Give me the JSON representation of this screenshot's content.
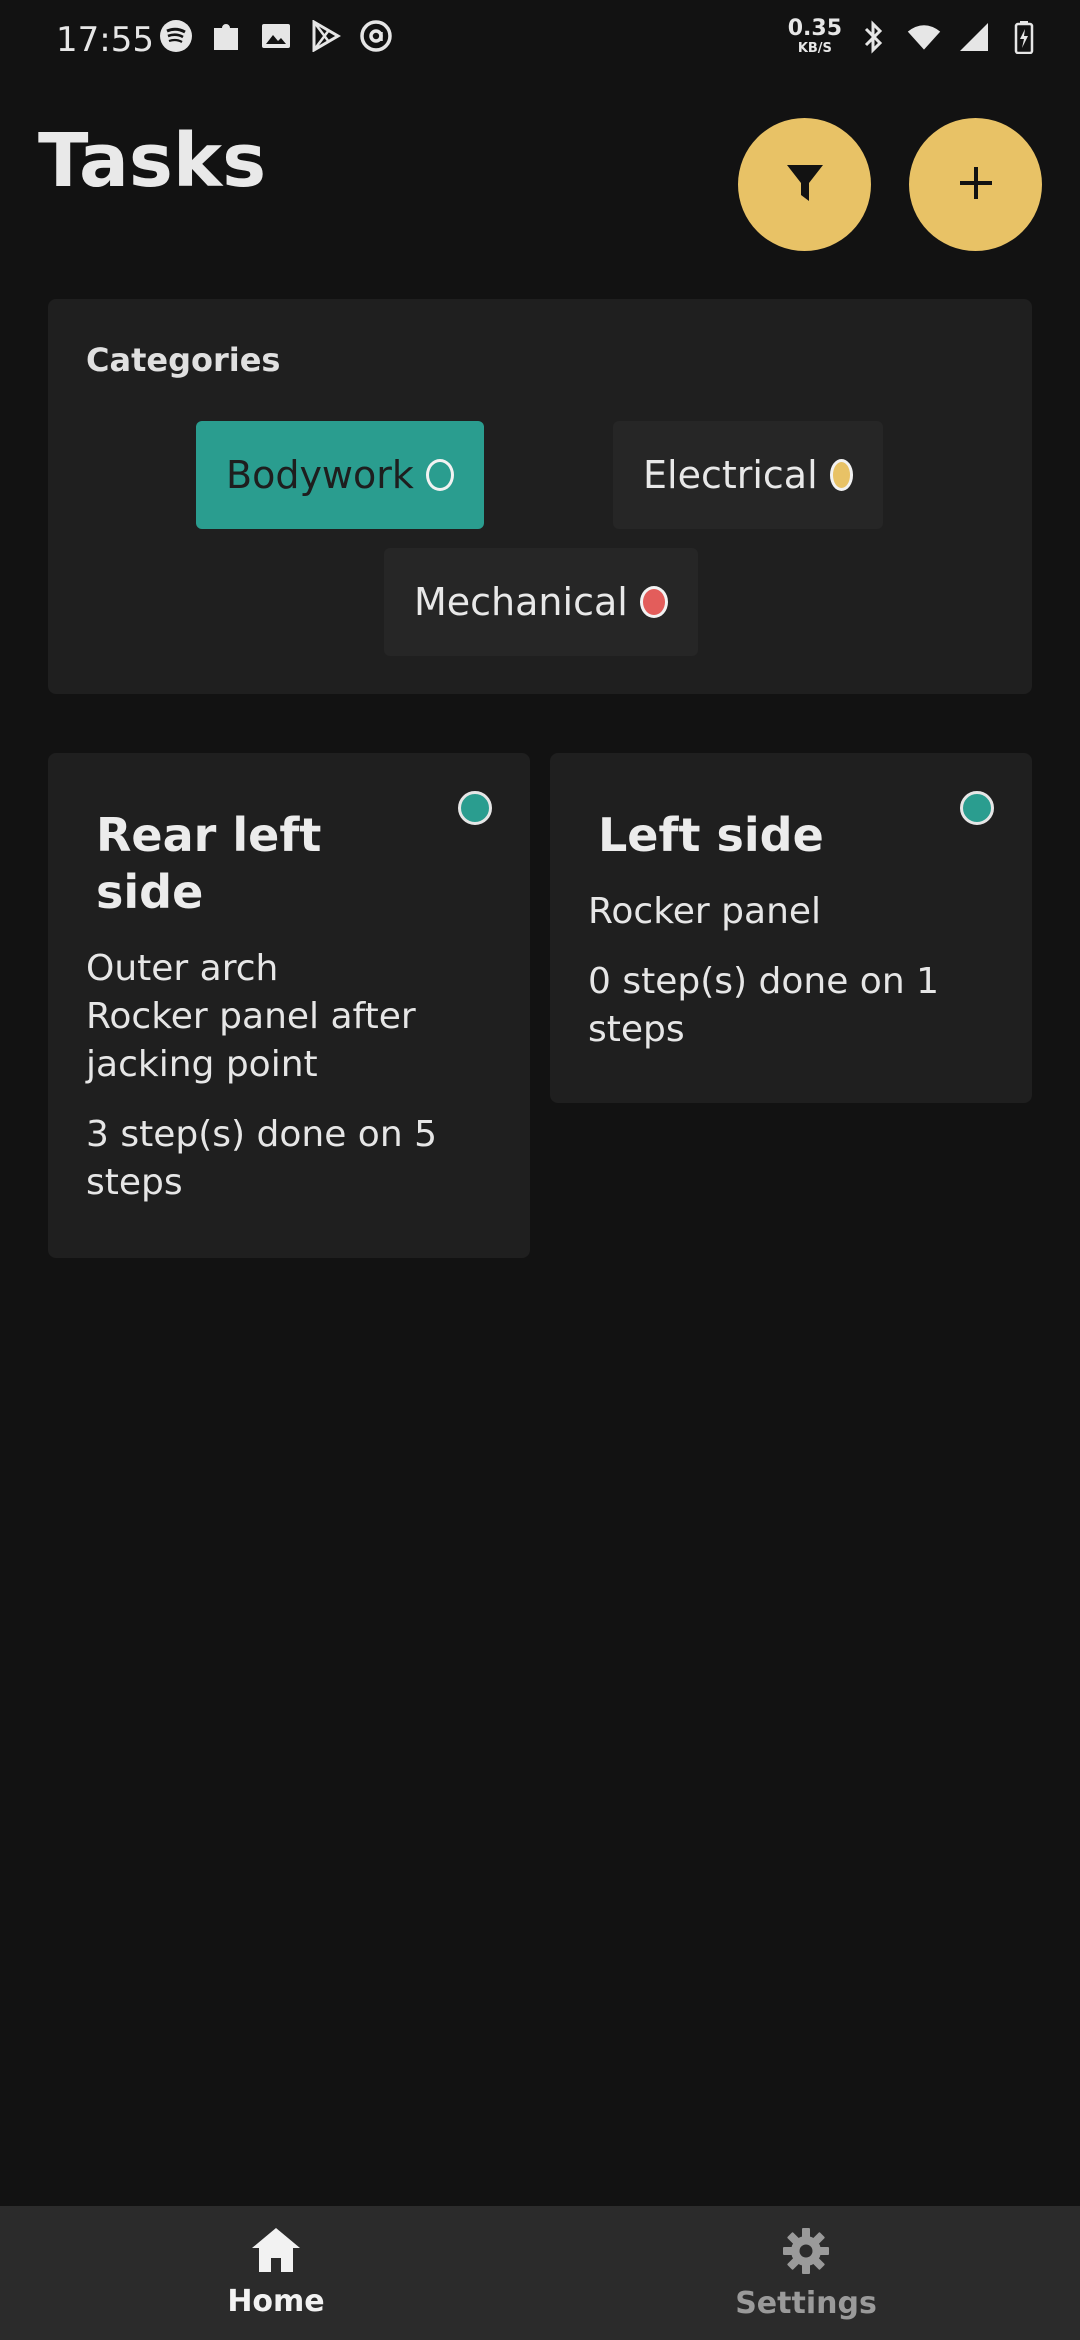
{
  "status_bar": {
    "time": "17:55",
    "net_speed_value": "0.35",
    "net_speed_unit": "KB/S",
    "left_icons": [
      "spotify-icon",
      "puzzle-icon",
      "image-icon",
      "play-store-icon",
      "at-sign-icon"
    ],
    "right_icons": [
      "bluetooth-icon",
      "wifi-icon",
      "signal-icon",
      "battery-icon"
    ]
  },
  "header": {
    "title": "Tasks",
    "filter_icon": "filter-icon",
    "add_icon": "plus-icon",
    "accent_color": "#e8c266"
  },
  "categories": {
    "title": "Categories",
    "items": [
      {
        "label": "Bodywork",
        "color": "#2a9d8f",
        "selected": true
      },
      {
        "label": "Electrical",
        "color": "#e8c266",
        "selected": false
      },
      {
        "label": "Mechanical",
        "color": "#e35d5b",
        "selected": false
      }
    ]
  },
  "tasks": [
    {
      "title": "Rear left side",
      "lines": [
        "Outer arch",
        "Rocker panel after jacking point"
      ],
      "steps": "3 step(s) done on 5 steps",
      "category_color": "#2a9d8f"
    },
    {
      "title": "Left side",
      "lines": [
        "Rocker panel"
      ],
      "steps": "0 step(s) done on 1 steps",
      "category_color": "#2a9d8f"
    }
  ],
  "bottom_nav": {
    "items": [
      {
        "label": "Home",
        "icon": "home-icon",
        "active": true
      },
      {
        "label": "Settings",
        "icon": "gear-icon",
        "active": false
      }
    ]
  }
}
